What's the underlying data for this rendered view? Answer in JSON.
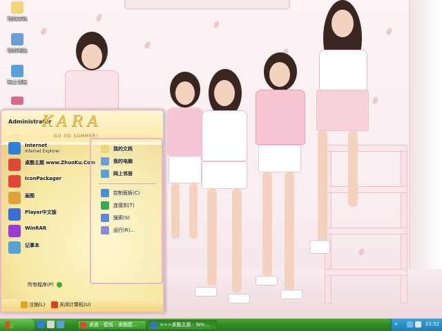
{
  "desktop": {
    "icons": [
      {
        "label": "我的文档",
        "color": "#f2d57a"
      },
      {
        "label": "我的电脑",
        "color": "#6b9ed6"
      },
      {
        "label": "网上邻居",
        "color": "#5aa0d8"
      },
      {
        "label": "",
        "color": "#d86a8a"
      }
    ]
  },
  "start_menu": {
    "user": "Administrator",
    "logo": "KARA",
    "logo_sub": "GO GO SUMMER!",
    "left_items": [
      {
        "title": "Internet",
        "subtitle": "Internet Explorer",
        "icon": "internet-explorer-icon",
        "color": "#2e7fd6"
      },
      {
        "title": "桌酷主题 www.ZhuoKu.Com",
        "subtitle": "",
        "icon": "zhuoku-icon",
        "color": "#d94a3a"
      },
      {
        "title": "IconPackager",
        "subtitle": "",
        "icon": "iconpackager-icon",
        "color": "#e0473a"
      },
      {
        "title": "画图",
        "subtitle": "",
        "icon": "paint-icon",
        "color": "#e0a23a"
      },
      {
        "title": "Player中文版",
        "subtitle": "",
        "icon": "player-icon",
        "color": "#3a6ed6"
      },
      {
        "title": "WinRAR",
        "subtitle": "",
        "icon": "winrar-icon",
        "color": "#9a3ad6"
      },
      {
        "title": "记事本",
        "subtitle": "",
        "icon": "notepad-icon",
        "color": "#5aa0d8"
      }
    ],
    "right_items": [
      {
        "label": "我的文档",
        "bold": true,
        "icon": "my-documents-icon",
        "color": "#f2d57a"
      },
      {
        "label": "我的电脑",
        "bold": true,
        "icon": "my-computer-icon",
        "color": "#6b9ed6"
      },
      {
        "label": "网上邻居",
        "bold": true,
        "icon": "network-icon",
        "color": "#5aa0d8"
      },
      {
        "label": "控制面板(C)",
        "bold": false,
        "icon": "control-panel-icon",
        "color": "#4a8ed6"
      },
      {
        "label": "连接到(T)",
        "bold": false,
        "icon": "connect-icon",
        "color": "#3aa65a"
      },
      {
        "label": "搜索(S)",
        "bold": false,
        "icon": "search-icon",
        "color": "#5a8ad6"
      },
      {
        "label": "运行(R)...",
        "bold": false,
        "icon": "run-icon",
        "color": "#8a8ad6"
      }
    ],
    "all_programs": "所有程序(P)",
    "logoff": "注销(L)",
    "shutdown": "关闭计算机(U)"
  },
  "taskbar": {
    "quicklaunch_colors": [
      "#2e7fd6",
      "#d6d6d6",
      "#5aa0d8"
    ],
    "tasks": [
      {
        "label": "桌面 - 壁纸 - 桌酷壁...",
        "color": "#d94a3a",
        "active": false
      },
      {
        "label": "=>>桌酷主题 - Win...",
        "color": "#3a6ed6",
        "active": true
      }
    ],
    "clock": "23:52"
  }
}
